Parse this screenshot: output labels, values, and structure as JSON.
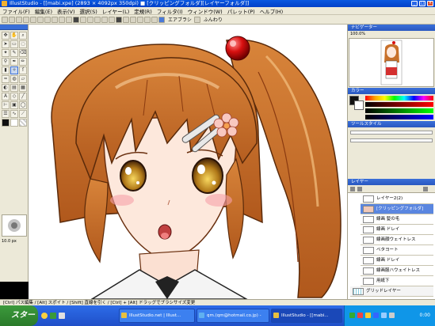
{
  "window": {
    "title": "IllustStudio - [[mabi.xpe] (2893 × 4092px 350dpi)  ■ [クリッピングフォルダ][レイヤーフォルダ]]"
  },
  "menu": [
    "ファイル(F)",
    "編集(E)",
    "表示(V)",
    "選択(S)",
    "レイヤー(L)",
    "定規(R)",
    "フィルタ(I)",
    "ウィンドウ(W)",
    "パレット(P)",
    "ヘルプ(H)"
  ],
  "toolbar": {
    "airbrush_label": "エアブラシ",
    "option_label": "ふんわり"
  },
  "tools": {
    "size_label": "10.0 px"
  },
  "panels": {
    "colorset": "カラーセット",
    "navigator": "ナビゲーター",
    "zoom": "100.0%",
    "color": "カラー",
    "toolstyle": "ツールスタイル",
    "layer": "レイヤー"
  },
  "layers": [
    {
      "name": "レイヤー2(2)"
    },
    {
      "name": "[クリッピングフォルダ]"
    },
    {
      "name": "線画 髪の毛"
    },
    {
      "name": "線画 ドレイ"
    },
    {
      "name": "線画顔ウェイトレス"
    },
    {
      "name": "ベタヨート"
    },
    {
      "name": "線画 ドレイ"
    },
    {
      "name": "線画服ハウェイトレス"
    },
    {
      "name": "用紙下"
    },
    {
      "name": "グリッドレイヤー"
    },
    {
      "name": "用紙"
    }
  ],
  "status": {
    "hint": "[Ctrl] パス編集 / [Alt] スポイト / [Shift] 直線を引く / [Ctrl] + [Alt] ドラッグでブラシサイズ変更"
  },
  "taskbar": {
    "start": "スタート",
    "tasks": [
      "IllustStudio.net | Illust...",
      "qm.(qm@hotmail.co.jp) -",
      "IllustStudio - [[mabi..."
    ],
    "clock": "0:00"
  },
  "colors": {
    "hair": "#c8702a",
    "title_bar": "#0a58e0",
    "bow": "#cc1010"
  }
}
